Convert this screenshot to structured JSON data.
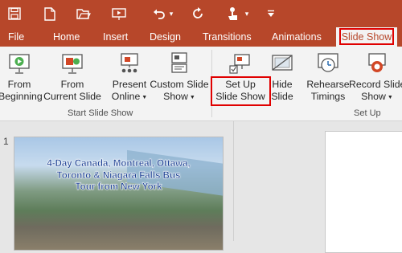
{
  "quick_access": {
    "icons": [
      "save-icon",
      "new-file-icon",
      "open-folder-icon",
      "from-beginning-icon",
      "undo-icon",
      "repeat-icon",
      "touch-mode-icon",
      "customize-icon"
    ],
    "undo_caret": "▾",
    "touch_caret": "▾",
    "more": "▾"
  },
  "tabs": [
    "File",
    "Home",
    "Insert",
    "Design",
    "Transitions",
    "Animations",
    "Slide Show"
  ],
  "active_tab": "Slide Show",
  "ribbon": {
    "start_group": {
      "label": "Start Slide Show",
      "buttons": [
        {
          "line1": "From",
          "line2": "Beginning"
        },
        {
          "line1": "From",
          "line2": "Current Slide"
        },
        {
          "line1": "Present",
          "line2": "Online"
        },
        {
          "line1": "Custom Slide",
          "line2": "Show"
        }
      ]
    },
    "setup_group": {
      "label": "Set Up",
      "buttons": [
        {
          "line1": "Set Up",
          "line2": "Slide Show"
        },
        {
          "line1": "Hide",
          "line2": "Slide"
        },
        {
          "line1": "Rehearse",
          "line2": "Timings"
        },
        {
          "line1": "Record Slide",
          "line2": "Show"
        }
      ]
    }
  },
  "slides": {
    "number": "1",
    "title_lines": [
      "4-Day Canada, Montreal, Ottawa,",
      "Toronto & Niagara Falls Bus",
      "Tour from New York"
    ]
  },
  "colors": {
    "accent": "#b7472a",
    "highlight": "#e00000",
    "ribbon_bg": "#f3f3f3"
  }
}
